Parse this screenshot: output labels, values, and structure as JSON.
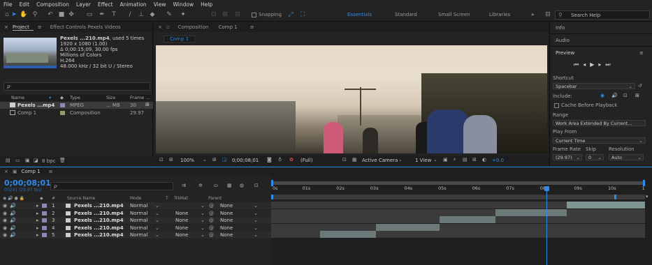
{
  "menu": [
    "File",
    "Edit",
    "Composition",
    "Layer",
    "Effect",
    "Animation",
    "View",
    "Window",
    "Help"
  ],
  "toolbar": {
    "snapping_label": "Snapping",
    "workspaces": [
      "Essentials",
      "Standard",
      "Small Screen",
      "Libraries"
    ],
    "overflow": "»",
    "search_placeholder": "Search Help"
  },
  "project": {
    "tab_project": "Project",
    "tab_effect_controls": "Effect Controls Pexels Videos",
    "menu_glyph": "≡",
    "file_name": "Pexels ...210.mp4",
    "used_times": ", used 5 times",
    "info_lines": [
      "1920 x 1080 (1.00)",
      "Δ 0;00:15;09, 30.00 fps",
      "Millions of Colors",
      "H.264",
      "48.000 kHz / 32 bit U / Stereo"
    ],
    "search_glyph": "ρ·",
    "columns": [
      "Name",
      "Type",
      "Size",
      "Frame ..."
    ],
    "items": [
      {
        "name": "Pexels ...mp4",
        "type": "MPEG",
        "size": "... MB",
        "fps": "30"
      },
      {
        "name": "Comp 1",
        "type": "Composition",
        "size": "",
        "fps": "29.97"
      }
    ],
    "bpc": "8 bpc"
  },
  "composition": {
    "tab_label": "Composition",
    "comp_name": "Comp 1",
    "breadcrumb": "Comp 1",
    "zoom": "100%",
    "timecode": "0;00;08;01",
    "resolution": "(Full)",
    "camera": "Active Camera",
    "view": "1 View",
    "exposure": "+0.0"
  },
  "right_panel": {
    "info": "Info",
    "audio": "Audio",
    "preview": "Preview",
    "menu_glyph": "≡",
    "shortcut_label": "Shortcut",
    "shortcut_value": "Spacebar",
    "include_label": "Include:",
    "cache_label": "Cache Before Playback",
    "range_label": "Range",
    "range_value": "Work Area Extended By Current...",
    "play_from_label": "Play From",
    "play_from_value": "Current Time",
    "frame_rate_label": "Frame Rate",
    "skip_label": "Skip",
    "resolution_label": "Resolution",
    "frame_rate_value": "(29.97)",
    "skip_value": "0",
    "resolution_value": "Auto"
  },
  "timeline": {
    "tab": "Comp 1",
    "timecode": "0;00;08;01",
    "fps_sub": "00241 (29.97 fps)",
    "search_glyph": "ρ·",
    "columns": {
      "num": "#",
      "source": "Source Name",
      "mode": "Mode",
      "t": "T",
      "trkmat": "TrkMat",
      "parent": "Parent"
    },
    "ruler": [
      "0s",
      "01s",
      "02s",
      "03s",
      "04s",
      "05s",
      "06s",
      "07s",
      "08s",
      "09s",
      "10s",
      "1"
    ],
    "layers": [
      {
        "num": "1",
        "name": "Pexels ...210.mp4",
        "mode": "Normal",
        "trkmat": "",
        "parent": "None",
        "start": 0.79,
        "end": 1.0
      },
      {
        "num": "2",
        "name": "Pexels ...210.mp4",
        "mode": "Normal",
        "trkmat": "None",
        "parent": "None",
        "start": 0.6,
        "end": 0.79
      },
      {
        "num": "3",
        "name": "Pexels ...210.mp4",
        "mode": "Normal",
        "trkmat": "None",
        "parent": "None",
        "start": 0.45,
        "end": 0.6
      },
      {
        "num": "4",
        "name": "Pexels ...210.mp4",
        "mode": "Normal",
        "trkmat": "None",
        "parent": "None",
        "start": 0.28,
        "end": 0.45
      },
      {
        "num": "5",
        "name": "Pexels ...210.mp4",
        "mode": "Normal",
        "trkmat": "None",
        "parent": "None",
        "start": 0.13,
        "end": 0.28
      }
    ],
    "playhead_fraction": 0.737
  }
}
